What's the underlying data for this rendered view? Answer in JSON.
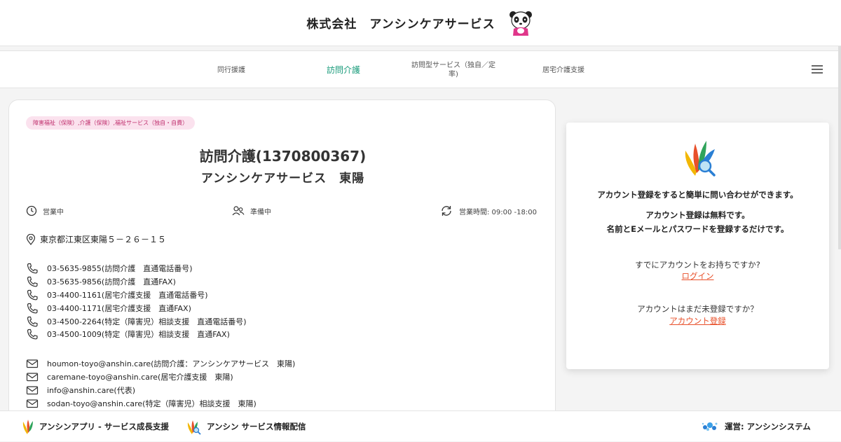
{
  "header": {
    "title": "株式会社　アンシンケアサービス",
    "mascot_icon": "panda-mascot-icon"
  },
  "nav": {
    "items": [
      {
        "label": "同行援護",
        "active": false
      },
      {
        "label": "訪問介護",
        "active": true
      },
      {
        "label_line1": "訪問型サービス（独自／定",
        "label_line2": "率)",
        "active": false
      },
      {
        "label": "居宅介護支援",
        "active": false
      }
    ],
    "menu_icon": "hamburger-menu-icon",
    "active_color": "#1b9c7c"
  },
  "office": {
    "tag": "障害福祉（保険）,介護（保険）,福祉サービス（独自・自費）",
    "service_title": "訪問介護(1370800367)",
    "name": "アンシンケアサービス　東陽",
    "status_open": "営業中",
    "status_prep": "準備中",
    "hours": "営業時間: 09:00 -18:00",
    "address": "東京都江東区東陽５－２６－１５",
    "phones": [
      "03-5635-9855(訪問介護　直通電話番号)",
      "03-5635-9856(訪問介護　直通FAX)",
      "03-4400-1161(居宅介護支援　直通電話番号)",
      "03-4400-1171(居宅介護支援　直通FAX)",
      "03-4500-2264(特定（障害児）相談支援　直通電話番号)",
      "03-4500-1009(特定（障害児）相談支援　直通FAX)"
    ],
    "emails": [
      "houmon-toyo@anshin.care(訪問介護：アンシンケアサービス　東陽)",
      "caremane-toyo@anshin.care(居宅介護支援　東陽)",
      "info@anshin.care(代表)",
      "sodan-toyo@anshin.care(特定（障害児）相談支援　東陽)"
    ],
    "tag_color": "#c0306e"
  },
  "account": {
    "line1": "アカウント登録をすると簡単に問い合わせができます。",
    "line2": "アカウント登録は無料です。",
    "line3": "名前とEメールとパスワードを登録するだけです。",
    "have_account_q": "すでにアカウントをお持ちですか?",
    "login_link": "ログイン",
    "no_account_q": "アカウントはまだ未登録ですか？",
    "register_link": "アカウント登録",
    "link_color": "#e8502a"
  },
  "footer": {
    "app_link": "アンシンアプリ - サービス成長支援",
    "info_link": "アンシン サービス情報配信",
    "operator": "運営: アンシンシステム"
  }
}
